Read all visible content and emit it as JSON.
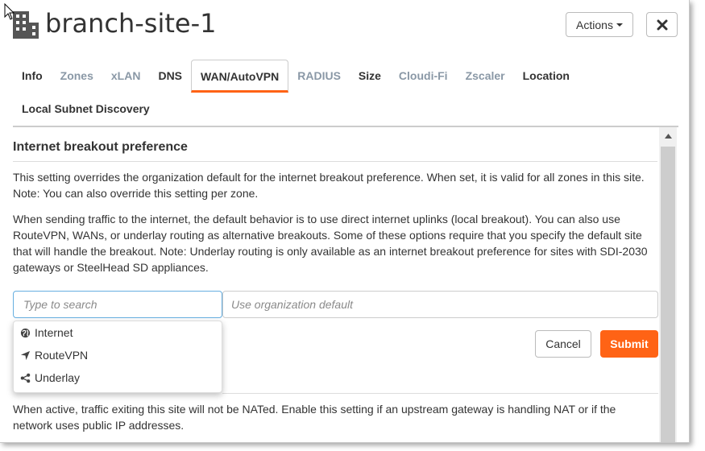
{
  "header": {
    "title": "branch-site-1",
    "actions_label": "Actions"
  },
  "tabs": [
    {
      "label": "Info",
      "state": "dark"
    },
    {
      "label": "Zones",
      "state": "muted"
    },
    {
      "label": "xLAN",
      "state": "muted"
    },
    {
      "label": "DNS",
      "state": "dark"
    },
    {
      "label": "WAN/AutoVPN",
      "state": "active"
    },
    {
      "label": "RADIUS",
      "state": "muted"
    },
    {
      "label": "Size",
      "state": "dark"
    },
    {
      "label": "Cloudi-Fi",
      "state": "muted"
    },
    {
      "label": "Zscaler",
      "state": "muted"
    },
    {
      "label": "Location",
      "state": "dark"
    },
    {
      "label": "Local Subnet Discovery",
      "state": "dark"
    }
  ],
  "section": {
    "title": "Internet breakout preference",
    "para1": "This setting overrides the organization default for the internet breakout preference. When set, it is valid for all zones in this site. Note: You can also override this setting per zone.",
    "para2": "When sending traffic to the internet, the default behavior is to use direct internet uplinks (local breakout). You can also use RouteVPN, WANs, or underlay routing as alternative breakouts. Some of these options require that you specify the default site that will handle the breakout. Note: Underlay routing is only available as an internet breakout preference for sites with SDI-2030 gateways or SteelHead SD appliances."
  },
  "search": {
    "placeholder": "Type to search",
    "value": ""
  },
  "default_field": {
    "placeholder": "Use organization default"
  },
  "dropdown": {
    "items": [
      {
        "label": "Internet",
        "icon": "globe-icon"
      },
      {
        "label": "RouteVPN",
        "icon": "location-arrow-icon"
      },
      {
        "label": "Underlay",
        "icon": "share-icon"
      }
    ]
  },
  "buttons": {
    "cancel": "Cancel",
    "submit": "Submit"
  },
  "nat_text": "When active, traffic exiting this site will not be NATed. Enable this setting if an upstream gateway is handling NAT or if the network uses public IP addresses.",
  "colors": {
    "accent": "#ff6315",
    "muted_tab": "#8a98a6",
    "focus_border": "#66aee0"
  }
}
